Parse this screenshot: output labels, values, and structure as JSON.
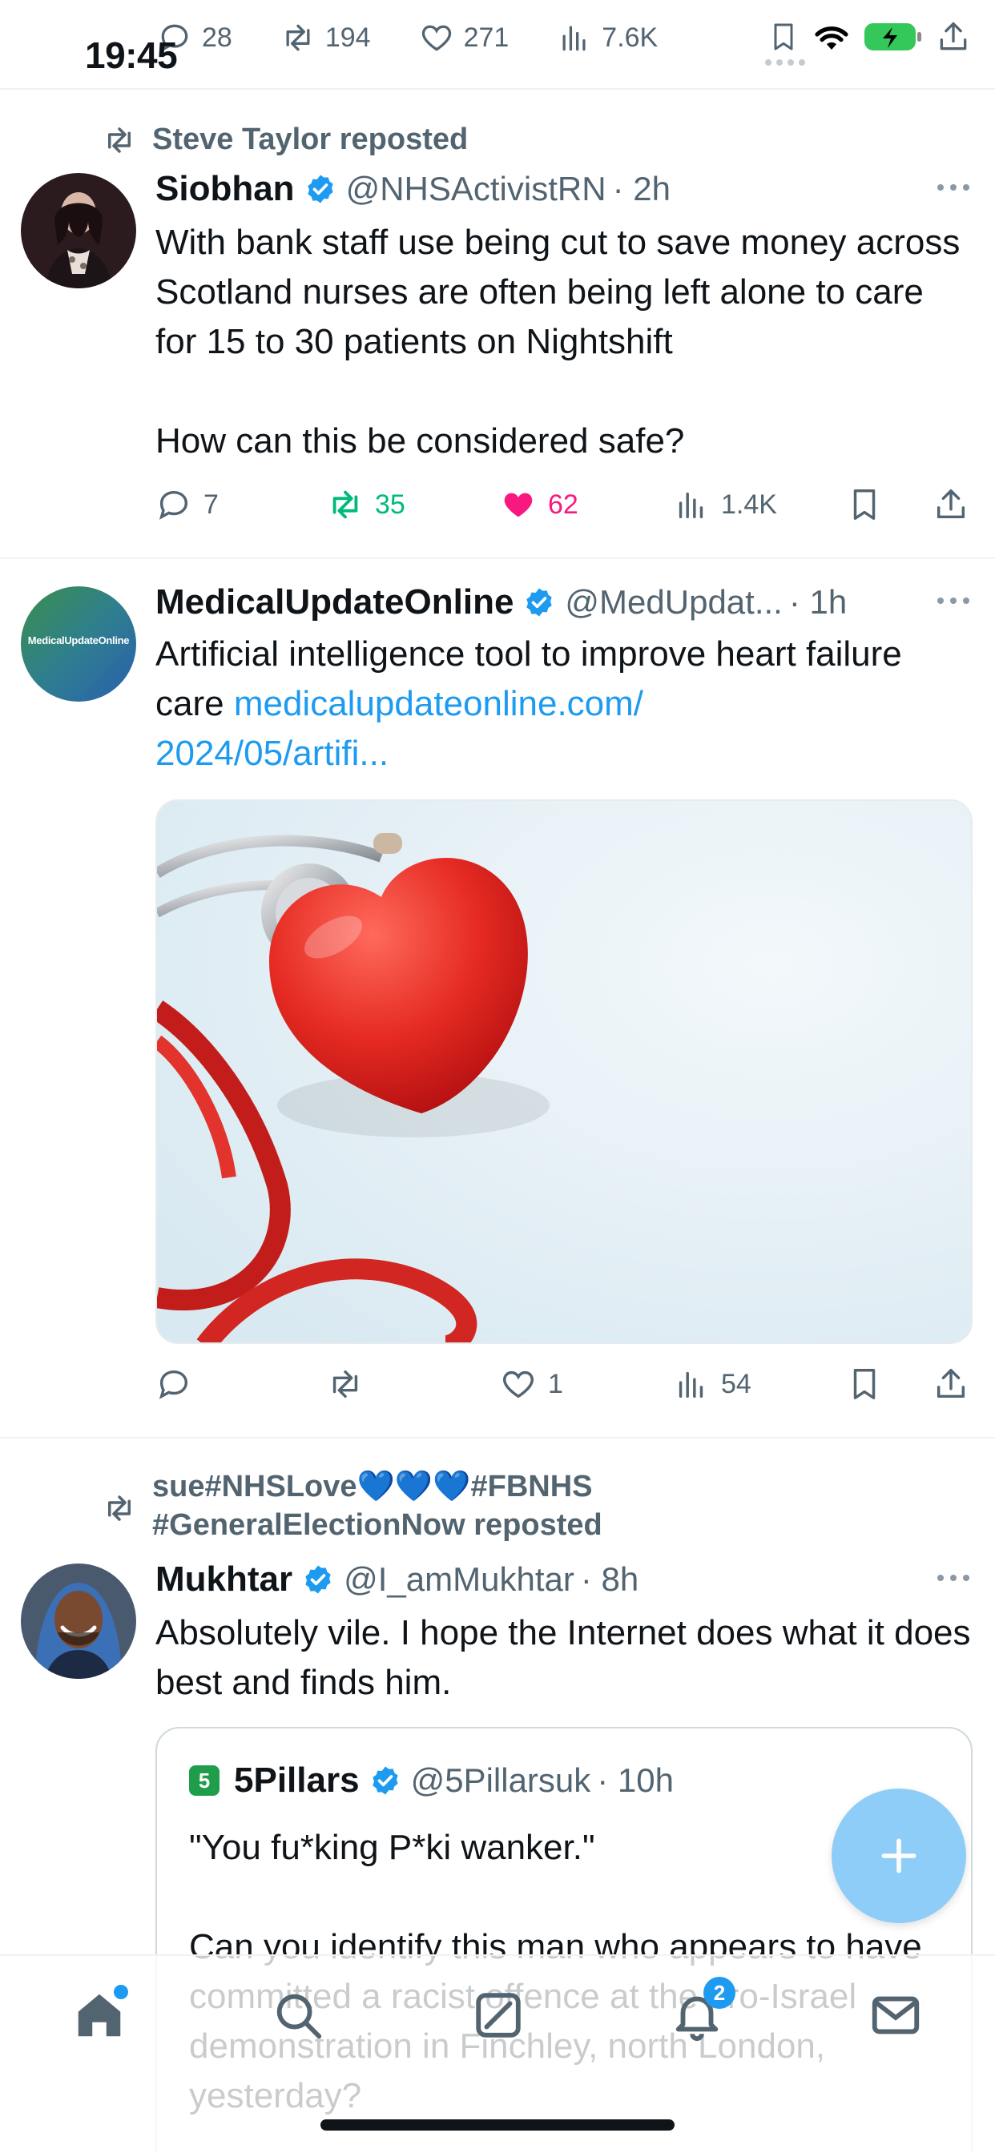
{
  "status_bar": {
    "time": "19:45",
    "prev_actions": {
      "replies": "28",
      "reposts": "194",
      "likes": "271",
      "views": "7.6K"
    }
  },
  "tweets": [
    {
      "reposted_by": "Steve Taylor reposted",
      "name": "Siobhan",
      "handle": "@NHSActivistRN",
      "time": "· 2h",
      "text": "With bank staff use being cut to save money across Scotland nurses are often being left alone to care for 15 to 30 patients on Nightshift\n\nHow can this be considered safe?",
      "replies": "7",
      "reposts": "35",
      "likes": "62",
      "views": "1.4K",
      "reposted_state": "reposted",
      "liked_state": "liked"
    },
    {
      "name": "MedicalUpdateOnline",
      "handle": "@MedUpdat...",
      "time": "· 1h",
      "avatar_text": "MedicalUpdateOnline",
      "text": "Artificial intelligence tool to improve heart failure care ",
      "link": "medicalupdateonline.com/\n2024/05/artifi...",
      "replies": "",
      "reposts": "",
      "likes": "1",
      "views": "54"
    },
    {
      "reposted_by": "sue#NHSLove💙💙💙#FBNHS\n#GeneralElectionNow reposted",
      "name": "Mukhtar",
      "handle": "@I_amMukhtar",
      "time": "· 8h",
      "text": "Absolutely vile. I hope the Internet does what it does best and finds him.",
      "quote": {
        "logo": "5",
        "name": "5Pillars",
        "handle": "@5Pillarsuk",
        "time": "· 10h",
        "text": "\"You fu*king P*ki wanker.\"\n\nCan you identify this man who appears to have committed a racist offence at the pro-Israel demonstration in Finchley, north London, yesterday?"
      }
    }
  ],
  "tab_bar": {
    "tabs": [
      "home-icon",
      "search-icon",
      "grok-icon",
      "bell-icon",
      "mail-icon"
    ],
    "notification_count": "2"
  },
  "colors": {
    "accent": "#1d9bf0",
    "repost_green": "#00ba7c",
    "like_pink": "#f91880",
    "secondary_text": "#536471"
  }
}
